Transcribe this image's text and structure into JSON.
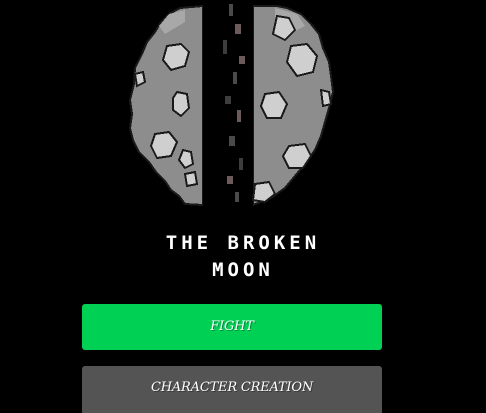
{
  "title": {
    "line1": "THE BROKEN",
    "line2": "MOON"
  },
  "art": {
    "icon": "broken-moon-icon",
    "colors": {
      "rock": "#8a8a8a",
      "rock_light": "#a6a6a6",
      "crater": "#cfcfcf",
      "outline": "#1a1a1a",
      "crack_debris": "#6d5a5a"
    }
  },
  "menu": {
    "fight_label": "FIGHT",
    "character_label": "CHARACTER CREATION",
    "fight_color": "#00d155",
    "character_color": "#545454"
  }
}
